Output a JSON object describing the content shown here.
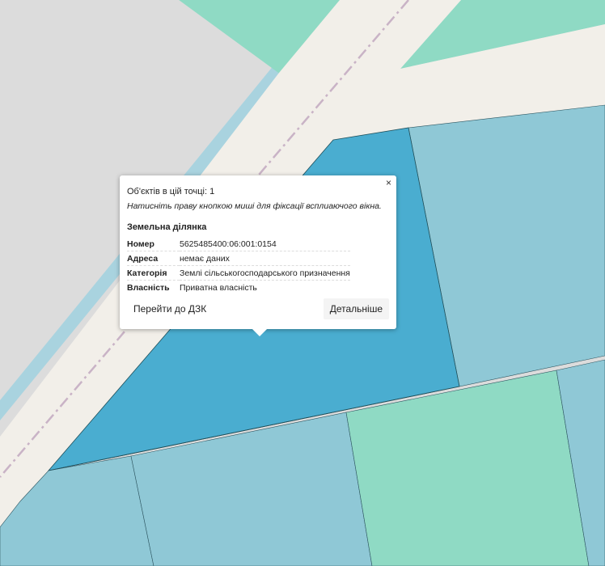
{
  "popup": {
    "close_label": "×",
    "count_text": "Об'єктів в цій точці: 1",
    "hint_text": "Натисніть праву кнопкою миші для фіксації всплиаючого вікна.",
    "object_title": "Земельна ділянка",
    "rows": [
      {
        "key": "Номер",
        "value": "5625485400:06:001:0154"
      },
      {
        "key": "Адреса",
        "value": "немає даних"
      },
      {
        "key": "Категорія",
        "value": "Землі сільськогосподарського призначення"
      },
      {
        "key": "Власність",
        "value": "Приватна власність"
      }
    ],
    "btn_dzk": "Перейти до ДЗК",
    "btn_details": "Детальніше"
  },
  "map": {
    "colors": {
      "background": "#dcdcdc",
      "road": "#f2efe9",
      "road_edge": "#a9d3df",
      "road_centerline": "#c9b3c6",
      "parcel_selected": "#4aadd0",
      "parcel_blue": "#8fc8d6",
      "parcel_green": "#8fdac4",
      "parcel_stroke": "#1f4f5a"
    }
  }
}
